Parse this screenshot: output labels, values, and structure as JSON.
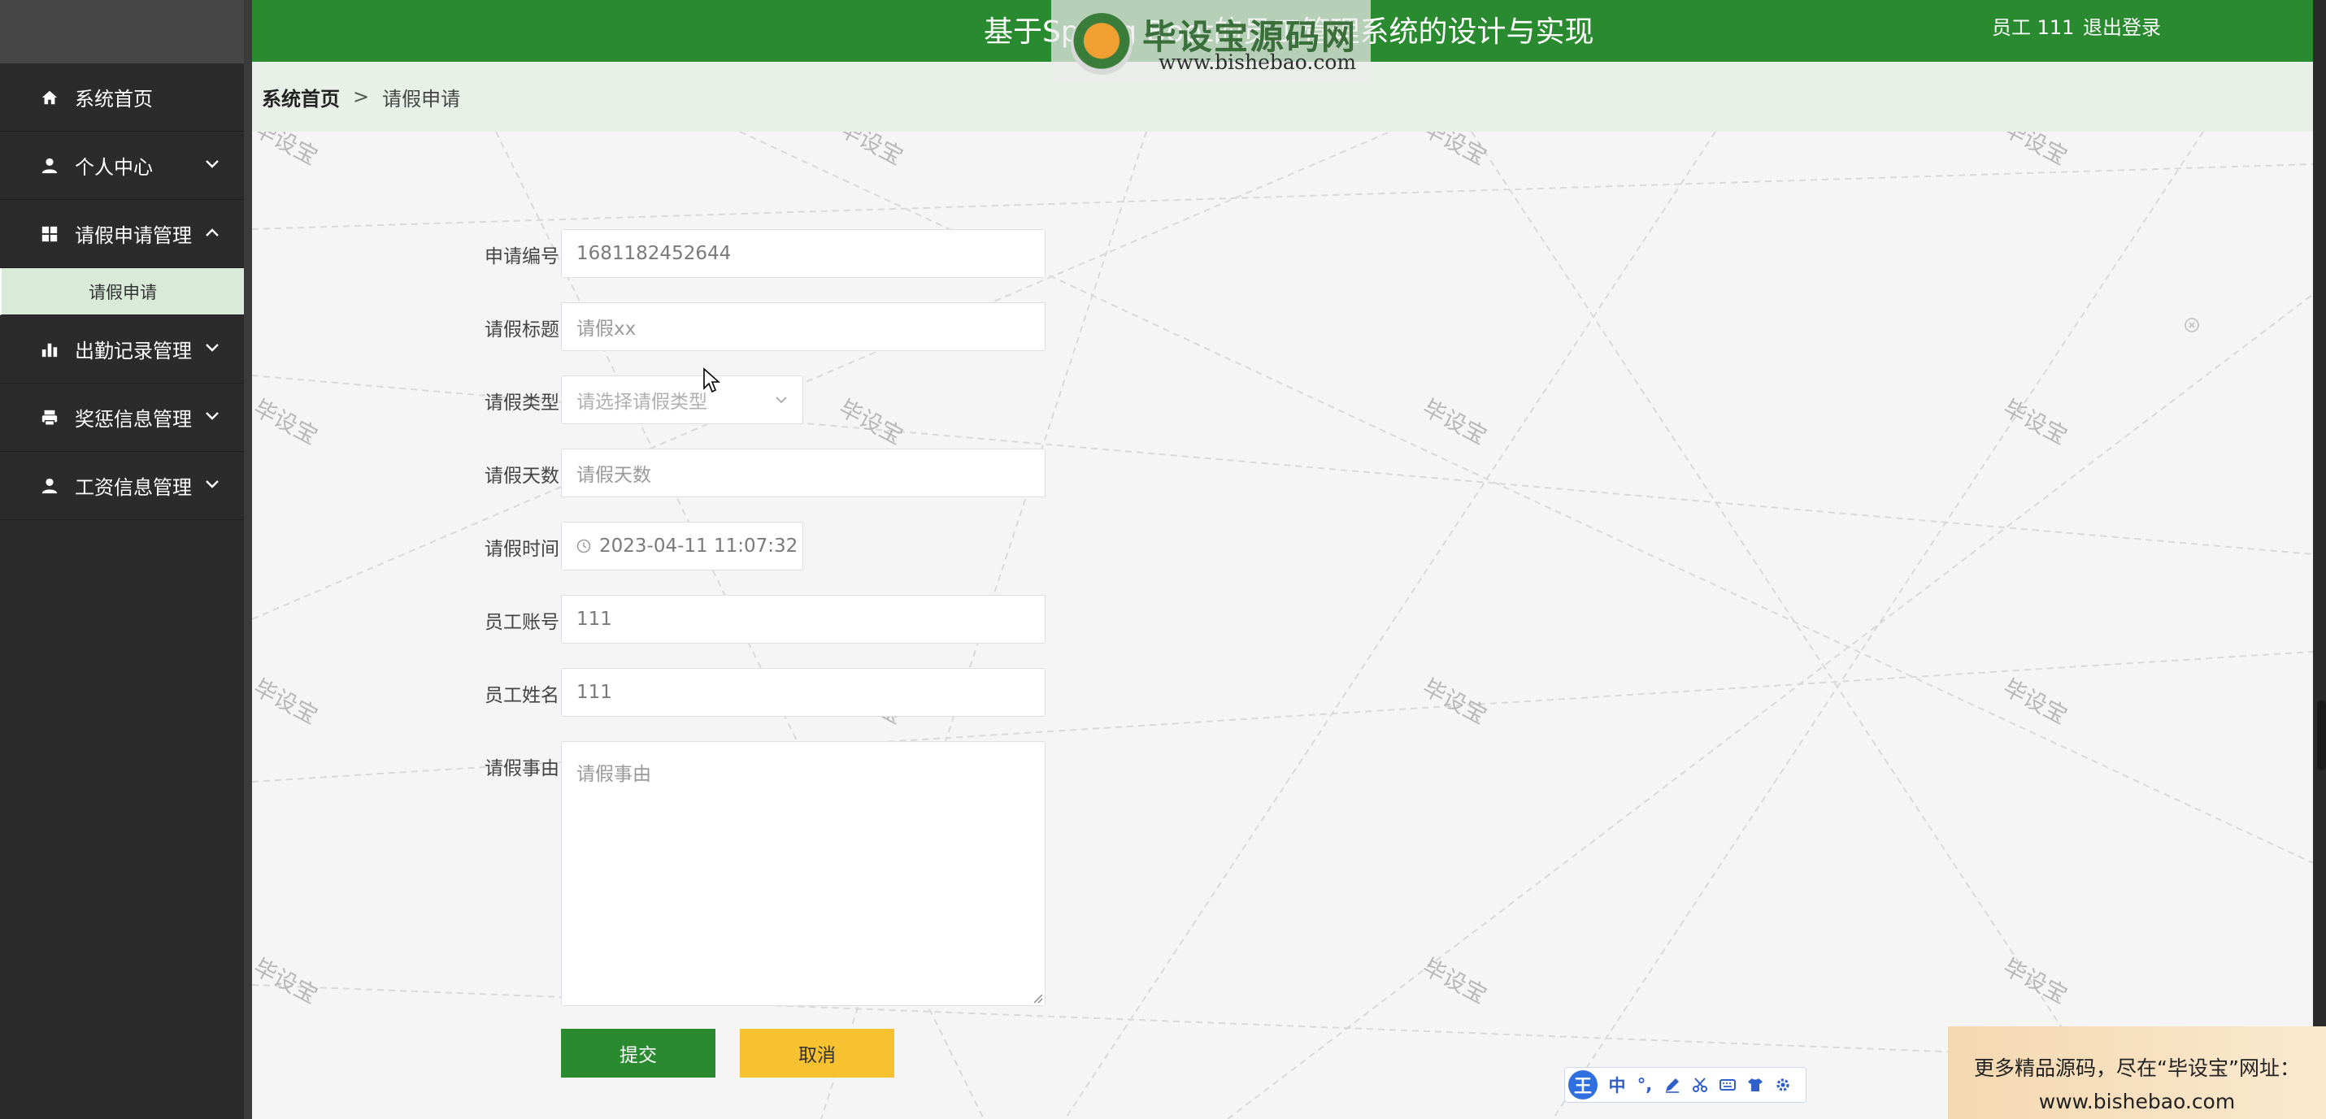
{
  "header": {
    "title": "基于Spring Boot的员工管理系统的设计与实现",
    "user": "员工 111",
    "logout": "退出登录"
  },
  "watermark_logo": {
    "title": "毕设宝源码网",
    "url": "www.bishebao.com"
  },
  "sidebar": {
    "items": [
      {
        "label": "系统首页",
        "icon": "home-icon"
      },
      {
        "label": "个人中心",
        "icon": "user-icon"
      },
      {
        "label": "请假申请管理",
        "icon": "grid-icon"
      },
      {
        "label": "出勤记录管理",
        "icon": "bar-chart-icon"
      },
      {
        "label": "奖惩信息管理",
        "icon": "printer-icon"
      },
      {
        "label": "工资信息管理",
        "icon": "user-icon"
      }
    ],
    "submenu": {
      "label": "请假申请"
    }
  },
  "breadcrumb": {
    "home": "系统首页",
    "separator": ">",
    "current": "请假申请"
  },
  "form": {
    "apply_no": {
      "label": "申请编号",
      "value": "1681182452644"
    },
    "leave_title": {
      "label": "请假标题",
      "placeholder": "请假xx"
    },
    "leave_type": {
      "label": "请假类型",
      "placeholder": "请选择请假类型"
    },
    "leave_days": {
      "label": "请假天数",
      "placeholder": "请假天数"
    },
    "leave_time": {
      "label": "请假时间",
      "value": "2023-04-11 11:07:32"
    },
    "employee_account": {
      "label": "员工账号",
      "value": "111"
    },
    "employee_name": {
      "label": "员工姓名",
      "value": "111"
    },
    "leave_reason": {
      "label": "请假事由",
      "placeholder": "请假事由"
    },
    "submit": "提交",
    "cancel": "取消"
  },
  "background_watermark": "毕设宝",
  "ime_toolbar": {
    "badge": "王",
    "lang": "中",
    "punct": "°,"
  },
  "promo": {
    "line1": "更多精品源码，尽在“毕设宝”网址：",
    "line2": "www.bishebao.com"
  },
  "colors": {
    "primary_green": "#2a8a2f",
    "cancel_yellow": "#f7c130",
    "sidebar_bg": "#2b2b2b",
    "breadcrumb_bg": "#e8f0e8"
  }
}
